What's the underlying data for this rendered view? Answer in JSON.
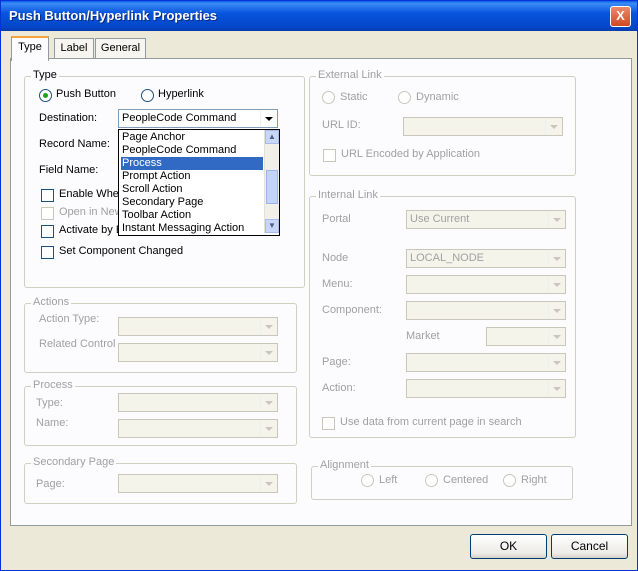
{
  "window": {
    "title": "Push Button/Hyperlink Properties",
    "close_glyph": "X"
  },
  "tabs": [
    {
      "label": "Type"
    },
    {
      "label": "Label"
    },
    {
      "label": "General"
    }
  ],
  "type_group": {
    "title": "Type",
    "push_button_label": "Push Button",
    "hyperlink_label": "Hyperlink",
    "selected": "Push Button",
    "destination_label": "Destination:",
    "destination_value": "PeopleCode Command",
    "record_name_label": "Record Name:",
    "field_name_label": "Field Name:",
    "enable_when_label": "Enable When",
    "open_in_new_label": "Open in New",
    "activate_by_label": "Activate by E",
    "set_component_changed_label": "Set Component Changed"
  },
  "destination_list": {
    "items": [
      "Page Anchor",
      "PeopleCode Command",
      "Process",
      "Prompt Action",
      "Scroll Action",
      "Secondary Page",
      "Toolbar Action",
      "Instant Messaging Action"
    ],
    "highlighted": "Process"
  },
  "external_link": {
    "title": "External Link",
    "static_label": "Static",
    "dynamic_label": "Dynamic",
    "url_id_label": "URL ID:",
    "url_encoded_label": "URL Encoded by Application"
  },
  "internal_link": {
    "title": "Internal Link",
    "portal_label": "Portal",
    "portal_value": "Use Current",
    "node_label": "Node",
    "node_value": "LOCAL_NODE",
    "menu_label": "Menu:",
    "component_label": "Component:",
    "market_label": "Market",
    "page_label": "Page:",
    "action_label": "Action:",
    "use_data_label": "Use data from current page in search"
  },
  "actions_group": {
    "title": "Actions",
    "action_type_label": "Action Type:",
    "related_control_label": "Related Control"
  },
  "process_group": {
    "title": "Process",
    "type_label": "Type:",
    "name_label": "Name:"
  },
  "secondary_page_group": {
    "title": "Secondary Page",
    "page_label": "Page:"
  },
  "alignment_group": {
    "title": "Alignment",
    "left_label": "Left",
    "centered_label": "Centered",
    "right_label": "Right"
  },
  "buttons": {
    "ok": "OK",
    "cancel": "Cancel"
  }
}
